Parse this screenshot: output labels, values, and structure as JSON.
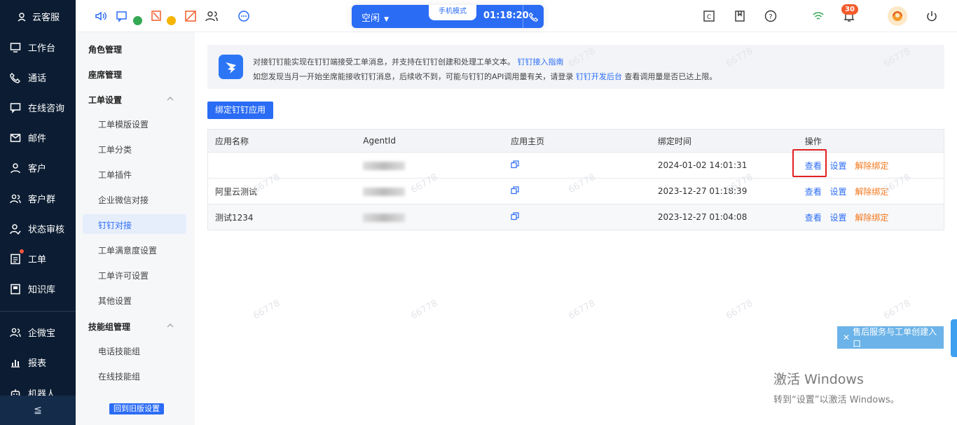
{
  "leftnav": {
    "brand": "云客服",
    "items": [
      "工作台",
      "通话",
      "在线咨询",
      "邮件",
      "客户",
      "客户群",
      "状态审核",
      "工单",
      "知识库",
      "企微宝",
      "报表",
      "机器人"
    ],
    "collapse_icon": "≦"
  },
  "topbar": {
    "call": {
      "status": "空闲",
      "mode": "手机模式",
      "timer": "01:18:20"
    },
    "notifications_count": "30"
  },
  "settings_sidebar": {
    "groups": [
      {
        "label": "角色管理"
      },
      {
        "label": "座席管理"
      },
      {
        "label": "工单设置",
        "items": [
          "工单模版设置",
          "工单分类",
          "工单插件",
          "企业微信对接",
          "钉钉对接",
          "工单满意度设置",
          "工单许可设置",
          "其他设置"
        ]
      },
      {
        "label": "技能组管理",
        "items": [
          "电话技能组",
          "在线技能组"
        ]
      }
    ],
    "active_item": "钉钉对接",
    "back_button": "回到旧版设置"
  },
  "banner": {
    "line1_text": "对接钉钉能实现在钉钉端接受工单消息，并支持在钉钉创建和处理工单文本。",
    "line1_link": "钉钉接入指南",
    "line2_text": "如您发现当月一开始坐席能接收钉钉消息，后续收不到，可能与钉钉的API调用量有关，请登录",
    "line2_link": "钉钉开发后台",
    "line2_tail": "查看调用量是否已达上限。"
  },
  "bind_button": "绑定钉钉应用",
  "table": {
    "headers": [
      "应用名称",
      "AgentId",
      "应用主页",
      "绑定时间",
      "操作"
    ],
    "rows": [
      {
        "name": "",
        "bind_time": "2024-01-02 14:01:31"
      },
      {
        "name": "阿里云测试",
        "bind_time": "2023-12-27 01:18:39"
      },
      {
        "name": "测试1234",
        "bind_time": "2023-12-27 01:04:08"
      }
    ],
    "actions": {
      "view": "查看",
      "settings": "设置",
      "unbind": "解除绑定"
    }
  },
  "watermark": "66778",
  "aftersale_button": "售后服务与工单创建入口",
  "windows_activation": {
    "title": "激活 Windows",
    "subtitle": "转到“设置”以激活 Windows。"
  }
}
